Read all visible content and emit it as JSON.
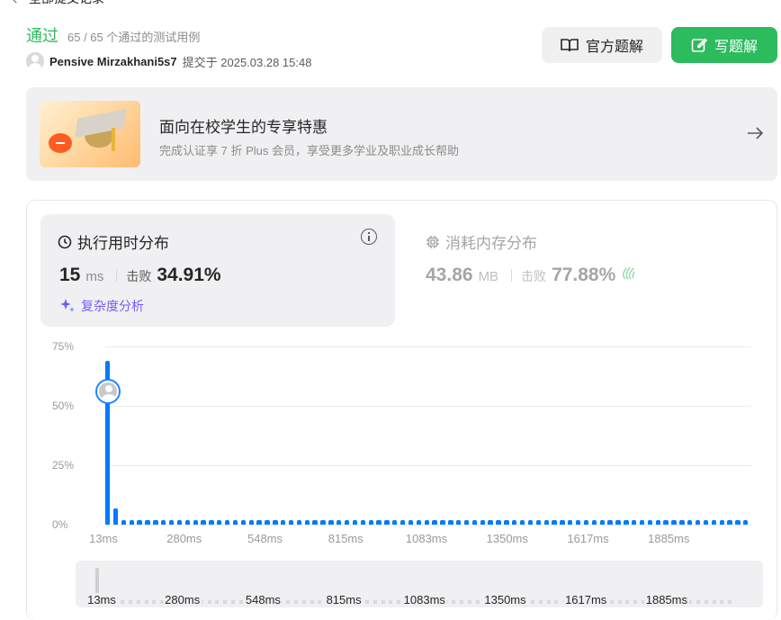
{
  "nav": {
    "back_text": "全部提交记录"
  },
  "status": {
    "label": "通过",
    "count": "65 / 65 个通过的测试用例"
  },
  "submission": {
    "user": "Pensive Mirzakhani5s7",
    "submitted_at": "提交于 2025.03.28 15:48"
  },
  "buttons": {
    "official_solution": "官方题解",
    "write_solution": "写题解"
  },
  "promo": {
    "title": "面向在校学生的专享特惠",
    "subtitle": "完成认证享 7 折 Plus 会员，享受更多学业及职业成长帮助"
  },
  "runtime": {
    "title": "执行用时分布",
    "value": "15",
    "unit": "ms",
    "beat_label": "击败",
    "beat_pct": "34.91%",
    "complexity_label": "复杂度分析"
  },
  "memory": {
    "title": "消耗内存分布",
    "value": "43.86",
    "unit": "MB",
    "beat_label": "击败",
    "beat_pct": "77.88%"
  },
  "colors": {
    "accent_green": "#2cbb5d",
    "bar_blue": "#007aff",
    "purple": "#7a5af8"
  },
  "chart_data": {
    "type": "bar",
    "title": "",
    "xlabel": "",
    "ylabel": "",
    "y_ticks": [
      "75%",
      "50%",
      "25%",
      "0%"
    ],
    "x_ticks": [
      "13ms",
      "280ms",
      "548ms",
      "815ms",
      "1083ms",
      "1350ms",
      "1617ms",
      "1885ms"
    ],
    "ylim": [
      0,
      75
    ],
    "grid": true,
    "user_bin_index": 0,
    "series": [
      {
        "values": [
          69,
          7,
          2,
          2,
          2,
          2,
          2,
          2,
          2,
          2,
          2,
          2,
          2,
          2,
          2,
          2,
          2,
          2,
          2,
          2,
          2,
          2,
          2,
          2,
          2,
          2,
          2,
          2,
          2,
          2,
          2,
          2,
          2,
          2,
          2,
          2,
          2,
          2,
          2,
          2,
          2,
          2,
          2,
          2,
          2,
          2,
          2,
          2,
          2,
          2,
          2,
          2,
          2,
          2,
          2,
          2,
          2,
          2,
          2,
          2,
          2,
          2,
          2,
          2,
          2,
          2,
          2,
          2,
          2,
          2,
          2,
          2,
          2,
          2,
          2,
          2,
          2,
          2,
          2,
          2,
          2
        ]
      }
    ]
  },
  "minimap": {
    "x_ticks": [
      "13ms",
      "280ms",
      "548ms",
      "815ms",
      "1083ms",
      "1350ms",
      "1617ms",
      "1885ms"
    ]
  }
}
